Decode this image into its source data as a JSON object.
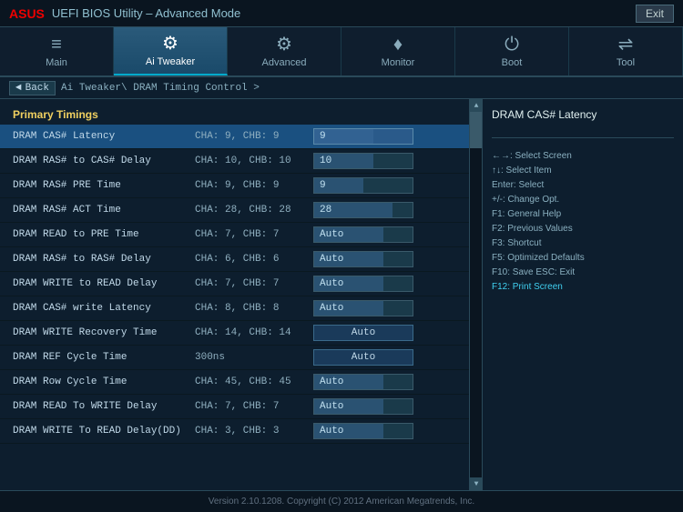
{
  "header": {
    "logo": "ASUS",
    "title": "UEFI BIOS Utility – Advanced Mode",
    "exit_label": "Exit"
  },
  "nav": {
    "tabs": [
      {
        "id": "main",
        "label": "Main",
        "icon": "≡",
        "active": false
      },
      {
        "id": "ai-tweaker",
        "label": "Ai Tweaker",
        "icon": "⚙",
        "active": true
      },
      {
        "id": "advanced",
        "label": "Advanced",
        "icon": "⚙",
        "active": false
      },
      {
        "id": "monitor",
        "label": "Monitor",
        "icon": "♦",
        "active": false
      },
      {
        "id": "boot",
        "label": "Boot",
        "icon": "⏻",
        "active": false
      },
      {
        "id": "tool",
        "label": "Tool",
        "icon": "⇌",
        "active": false
      }
    ]
  },
  "breadcrumb": {
    "back_label": "Back",
    "path": "Ai Tweaker\\ DRAM Timing Control >"
  },
  "left_panel": {
    "section_label": "Primary Timings",
    "rows": [
      {
        "name": "DRAM CAS# Latency",
        "cha": "CHA: 9, CHB: 9",
        "value": "9",
        "type": "bar",
        "selected": true,
        "fill_pct": 60
      },
      {
        "name": "DRAM RAS# to CAS# Delay",
        "cha": "CHA: 10, CHB: 10",
        "value": "10",
        "type": "bar",
        "selected": false,
        "fill_pct": 60
      },
      {
        "name": "DRAM RAS# PRE Time",
        "cha": "CHA: 9, CHB: 9",
        "value": "9",
        "type": "bar",
        "selected": false,
        "fill_pct": 50
      },
      {
        "name": "DRAM RAS# ACT Time",
        "cha": "CHA: 28, CHB: 28",
        "value": "28",
        "type": "bar",
        "selected": false,
        "fill_pct": 80
      },
      {
        "name": "DRAM READ to PRE Time",
        "cha": "CHA: 7, CHB: 7",
        "value": "Auto",
        "type": "bar",
        "selected": false,
        "fill_pct": 70
      },
      {
        "name": "DRAM RAS# to RAS# Delay",
        "cha": "CHA: 6, CHB: 6",
        "value": "Auto",
        "type": "bar",
        "selected": false,
        "fill_pct": 70
      },
      {
        "name": "DRAM WRITE to READ Delay",
        "cha": "CHA: 7, CHB: 7",
        "value": "Auto",
        "type": "bar",
        "selected": false,
        "fill_pct": 70
      },
      {
        "name": "DRAM CAS# write Latency",
        "cha": "CHA: 8, CHB: 8",
        "value": "Auto",
        "type": "bar",
        "selected": false,
        "fill_pct": 70
      },
      {
        "name": "DRAM WRITE Recovery Time",
        "cha": "CHA: 14, CHB: 14",
        "value": "Auto",
        "type": "button",
        "selected": false
      },
      {
        "name": "DRAM REF Cycle Time",
        "cha": "300ns",
        "value": "Auto",
        "type": "button",
        "selected": false
      },
      {
        "name": "DRAM Row Cycle Time",
        "cha": "CHA: 45, CHB: 45",
        "value": "Auto",
        "type": "bar",
        "selected": false,
        "fill_pct": 70
      },
      {
        "name": "DRAM READ To WRITE Delay",
        "cha": "CHA: 7, CHB: 7",
        "value": "Auto",
        "type": "bar",
        "selected": false,
        "fill_pct": 70
      },
      {
        "name": "DRAM WRITE To READ Delay(DD)",
        "cha": "CHA: 3, CHB: 3",
        "value": "Auto",
        "type": "bar",
        "selected": false,
        "fill_pct": 70
      }
    ]
  },
  "right_panel": {
    "title": "DRAM CAS# Latency",
    "description": "",
    "divider": true,
    "help": [
      {
        "text": "←→: Select Screen",
        "style": "normal"
      },
      {
        "text": "↑↓: Select Item",
        "style": "normal"
      },
      {
        "text": "Enter: Select",
        "style": "normal"
      },
      {
        "text": "+/-: Change Opt.",
        "style": "normal"
      },
      {
        "text": "F1: General Help",
        "style": "normal"
      },
      {
        "text": "F2: Previous Values",
        "style": "normal"
      },
      {
        "text": "F3: Shortcut",
        "style": "normal"
      },
      {
        "text": "F5: Optimized Defaults",
        "style": "normal"
      },
      {
        "text": "F10: Save  ESC: Exit",
        "style": "normal"
      },
      {
        "text": "F12: Print Screen",
        "style": "cyan"
      }
    ]
  },
  "footer": {
    "text": "Version 2.10.1208. Copyright (C) 2012 American Megatrends, Inc."
  }
}
